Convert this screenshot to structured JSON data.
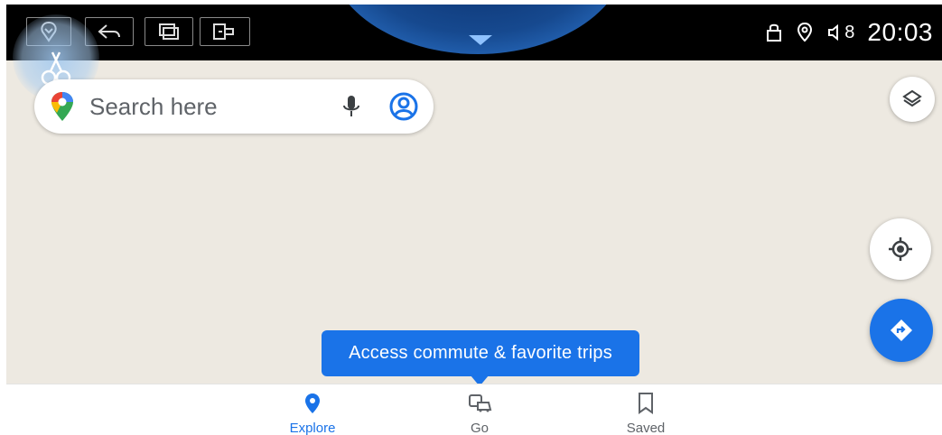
{
  "status_bar": {
    "time": "20:03",
    "volume": "8"
  },
  "search": {
    "placeholder": "Search here"
  },
  "tooltip": {
    "text": "Access commute & favorite trips"
  },
  "bottom_nav": {
    "items": [
      {
        "label": "Explore",
        "icon": "location-pin-icon",
        "active": true
      },
      {
        "label": "Go",
        "icon": "commute-icon",
        "active": false
      },
      {
        "label": "Saved",
        "icon": "bookmark-icon",
        "active": false
      }
    ]
  },
  "colors": {
    "accent": "#1a73e8",
    "map_background": "#ede9e1",
    "status_bar": "#000000"
  }
}
